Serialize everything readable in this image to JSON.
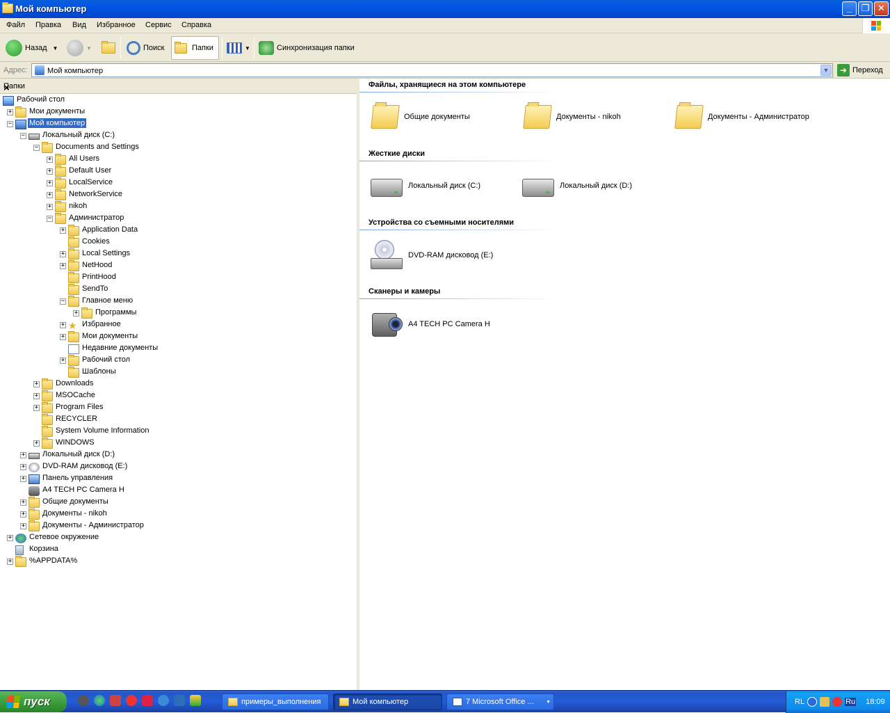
{
  "window": {
    "title": "Мой компьютер",
    "buttons": {
      "minimize": "_",
      "maximize": "❐",
      "close": "✕"
    }
  },
  "menu": [
    "Файл",
    "Правка",
    "Вид",
    "Избранное",
    "Сервис",
    "Справка"
  ],
  "toolbar": {
    "back": "Назад",
    "search": "Поиск",
    "folders": "Папки",
    "sync": "Синхронизация папки"
  },
  "address": {
    "label": "Адрес:",
    "value": "Мой компьютер",
    "go": "Переход"
  },
  "folder_pane": {
    "title": "Папки",
    "close": "×",
    "tree": [
      {
        "label": "Рабочий стол",
        "exp": ""
      },
      {
        "label": "Мои документы",
        "exp": "+"
      },
      {
        "label": "Мой компьютер",
        "exp": "−",
        "selected": true
      },
      {
        "label": "Локальный диск (C:)",
        "exp": "−"
      },
      {
        "label": "Documents and Settings",
        "exp": "−"
      },
      {
        "label": "All Users",
        "exp": "+"
      },
      {
        "label": "Default User",
        "exp": "+"
      },
      {
        "label": "LocalService",
        "exp": "+"
      },
      {
        "label": "NetworkService",
        "exp": "+"
      },
      {
        "label": "nikoh",
        "exp": "+"
      },
      {
        "label": "Администратор",
        "exp": "−"
      },
      {
        "label": "Application Data",
        "exp": "+"
      },
      {
        "label": "Cookies",
        "exp": ""
      },
      {
        "label": "Local Settings",
        "exp": "+"
      },
      {
        "label": "NetHood",
        "exp": "+"
      },
      {
        "label": "PrintHood",
        "exp": ""
      },
      {
        "label": "SendTo",
        "exp": ""
      },
      {
        "label": "Главное меню",
        "exp": "−"
      },
      {
        "label": "Программы",
        "exp": "+"
      },
      {
        "label": "Избранное",
        "exp": "+"
      },
      {
        "label": "Мои документы",
        "exp": "+"
      },
      {
        "label": "Недавние документы",
        "exp": ""
      },
      {
        "label": "Рабочий стол",
        "exp": "+"
      },
      {
        "label": "Шаблоны",
        "exp": ""
      },
      {
        "label": "Downloads",
        "exp": "+"
      },
      {
        "label": "MSOCache",
        "exp": "+"
      },
      {
        "label": "Program Files",
        "exp": "+"
      },
      {
        "label": "RECYCLER",
        "exp": ""
      },
      {
        "label": "System Volume Information",
        "exp": ""
      },
      {
        "label": "WINDOWS",
        "exp": "+"
      },
      {
        "label": "Локальный диск (D:)",
        "exp": "+"
      },
      {
        "label": "DVD-RAM дисковод (E:)",
        "exp": "+"
      },
      {
        "label": "Панель управления",
        "exp": "+"
      },
      {
        "label": "A4 TECH PC Camera H",
        "exp": ""
      },
      {
        "label": "Общие документы",
        "exp": "+"
      },
      {
        "label": "Документы - nikoh",
        "exp": "+"
      },
      {
        "label": "Документы - Администратор",
        "exp": "+"
      },
      {
        "label": "Сетевое окружение",
        "exp": "+"
      },
      {
        "label": "Корзина",
        "exp": ""
      },
      {
        "label": "%APPDATA%",
        "exp": "+"
      }
    ]
  },
  "content": {
    "groups": [
      {
        "title": "Файлы, хранящиеся на этом компьютере",
        "items": [
          "Общие документы",
          "Документы - nikoh",
          "Документы - Администратор"
        ]
      },
      {
        "title": "Жесткие диски",
        "items": [
          "Локальный диск (C:)",
          "Локальный диск (D:)"
        ]
      },
      {
        "title": "Устройства со съемными носителями",
        "items": [
          "DVD-RAM дисковод (E:)"
        ]
      },
      {
        "title": "Сканеры и камеры",
        "items": [
          "A4 TECH PC Camera H"
        ]
      }
    ]
  },
  "taskbar": {
    "start": "пуск",
    "tasks": [
      "примеры_выполнения",
      "Мой компьютер",
      "7 Microsoft Office ..."
    ],
    "tray_lang": "RL",
    "tray_ru": "Ru",
    "clock": "18:09"
  }
}
